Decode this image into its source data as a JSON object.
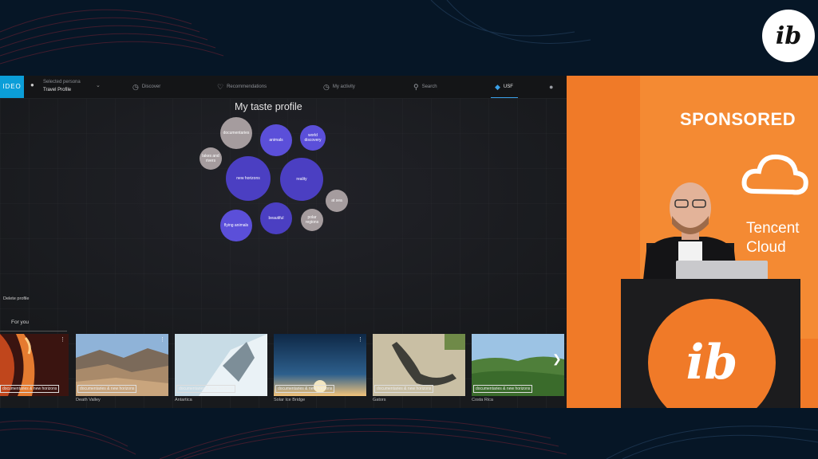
{
  "brand": {
    "label": "IDEO",
    "accent": "#0b9ed8"
  },
  "persona": {
    "label": "Selected persona",
    "value": "Travel Profile"
  },
  "nav": [
    {
      "label": "Discover",
      "icon": "compass-icon"
    },
    {
      "label": "Recommendations",
      "icon": "heart-icon"
    },
    {
      "label": "My activity",
      "icon": "activity-icon"
    },
    {
      "label": "Search",
      "icon": "search-icon"
    },
    {
      "label": "USF",
      "icon": "usf-icon",
      "active": true
    }
  ],
  "taste_profile": {
    "title": "My taste profile",
    "bubbles": [
      {
        "label": "documentaries",
        "color": "gray"
      },
      {
        "label": "animals",
        "color": "blue"
      },
      {
        "label": "world discovery",
        "color": "blue"
      },
      {
        "label": "lakes and rivers",
        "color": "gray"
      },
      {
        "label": "new horizons",
        "color": "dblue"
      },
      {
        "label": "reality",
        "color": "dblue"
      },
      {
        "label": "at sea",
        "color": "gray"
      },
      {
        "label": "beautiful",
        "color": "dblue"
      },
      {
        "label": "polar regions",
        "color": "gray"
      },
      {
        "label": "flying animals",
        "color": "blue"
      }
    ]
  },
  "delete_profile": "Delete profile",
  "section_title": "For you",
  "cards": [
    {
      "title": "",
      "tag": "documentaries & new horizons"
    },
    {
      "title": "Death Valley",
      "tag": "documentaries & new horizons"
    },
    {
      "title": "Antartica",
      "tag": "documentaries & new horizons"
    },
    {
      "title": "Solar Ice Bridge",
      "tag": "documentaries & new horizons"
    },
    {
      "title": "Gators",
      "tag": "documentaries & new horizons"
    },
    {
      "title": "Costa Rica",
      "tag": "documentaries & new horizons"
    }
  ],
  "stage": {
    "sponsored": "SPONSORED",
    "sponsor_line1": "Tencent",
    "sponsor_line2": "Cloud",
    "logo": "ibc"
  },
  "colors": {
    "stage_orange": "#f07a28",
    "bubble_blue": "#5b4fd9",
    "bubble_gray": "#a59c9e"
  }
}
